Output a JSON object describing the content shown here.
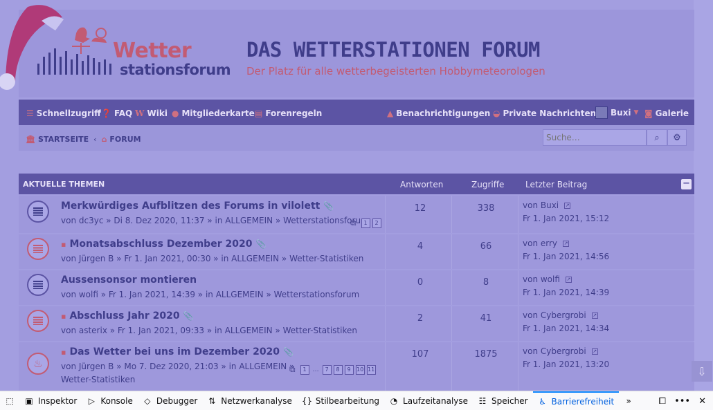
{
  "header": {
    "logo_main": "Wetter",
    "logo_sub": "stationsforum",
    "site_title": "DAS WETTERSTATIONEN FORUM",
    "site_description": "Der Platz für alle wetterbegeisterten Hobbymeteorologen"
  },
  "navbar": {
    "quick_access": "Schnellzugriff",
    "faq": "FAQ",
    "wiki": "Wiki",
    "member_map": "Mitgliederkarte",
    "forum_rules": "Forenregeln",
    "notifications": "Benachrichtigungen",
    "private_messages": "Private Nachrichten",
    "user": "Buxi",
    "gallery": "Galerie"
  },
  "breadcrumb": {
    "home": "STARTSEITE",
    "separator": "‹",
    "forum": "FORUM"
  },
  "search": {
    "placeholder": "Suche…"
  },
  "topics": {
    "header_title": "AKTUELLE THEMEN",
    "col_replies": "Antworten",
    "col_views": "Zugriffe",
    "col_last_post": "Letzter Beitrag",
    "rows": [
      {
        "title": "Merkwürdiges Aufblitzen des Forums in vilolett",
        "meta": "von dc3yc » Di 8. Dez 2020, 11:37 » in ALLGEMEIN » Wetterstationsforum",
        "pages": [
          "1",
          "2"
        ],
        "replies": "12",
        "views": "338",
        "last_by": "von Buxi",
        "last_time": "Fr 1. Jan 2021, 15:12"
      },
      {
        "title": "Monatsabschluss Dezember 2020",
        "meta": "von Jürgen B » Fr 1. Jan 2021, 00:30 » in ALLGEMEIN » Wetter-Statistiken",
        "replies": "4",
        "views": "66",
        "last_by": "von erry",
        "last_time": "Fr 1. Jan 2021, 14:56"
      },
      {
        "title": "Aussensonsor montieren",
        "meta": "von wolfi » Fr 1. Jan 2021, 14:39 » in ALLGEMEIN » Wetterstationsforum",
        "replies": "0",
        "views": "8",
        "last_by": "von wolfi",
        "last_time": "Fr 1. Jan 2021, 14:39"
      },
      {
        "title": "Abschluss Jahr 2020",
        "meta": "von asterix » Fr 1. Jan 2021, 09:33 » in ALLGEMEIN » Wetter-Statistiken",
        "replies": "2",
        "views": "41",
        "last_by": "von Cybergrobi",
        "last_time": "Fr 1. Jan 2021, 14:34"
      },
      {
        "title": "Das Wetter bei uns im Dezember 2020",
        "meta": "von Jürgen B » Mo 7. Dez 2020, 21:03 » in ALLGEMEIN »",
        "meta2": "Wetter-Statistiken",
        "pages": [
          "1",
          "…",
          "7",
          "8",
          "9",
          "10",
          "11"
        ],
        "replies": "107",
        "views": "1875",
        "last_by": "von Cybergrobi",
        "last_time": "Fr 1. Jan 2021, 13:20"
      }
    ]
  },
  "devtools": {
    "inspector": "Inspektor",
    "console": "Konsole",
    "debugger": "Debugger",
    "network": "Netzwerkanalyse",
    "style_editor": "Stilbearbeitung",
    "performance": "Laufzeitanalyse",
    "storage": "Speicher",
    "accessibility": "Barrierefreiheit"
  },
  "colors": {
    "accent": "#5c54a4",
    "brand_red": "#c25b73",
    "devtools_active": "#0060df"
  }
}
